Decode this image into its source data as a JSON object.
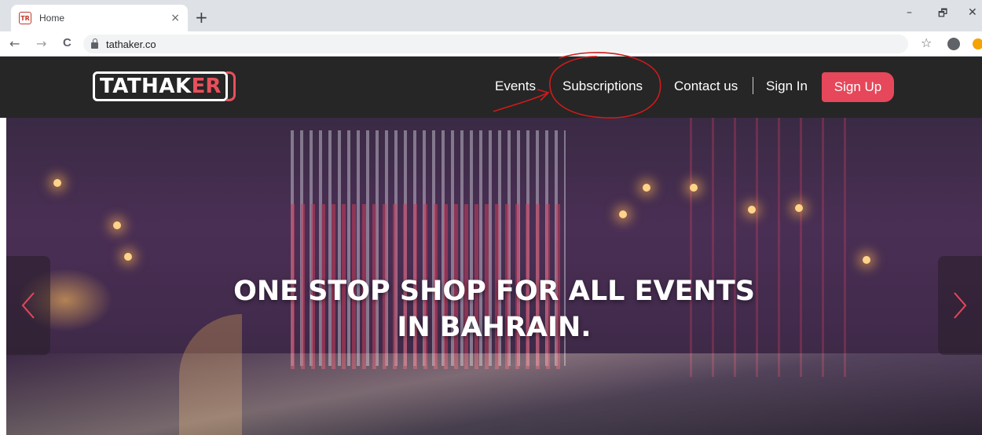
{
  "browser": {
    "tab_title": "Home",
    "tab_close": "×",
    "new_tab": "+",
    "favicon": "TR",
    "url": "tathaker.co",
    "nav": {
      "back": "←",
      "forward": "→",
      "reload": "C"
    },
    "window": {
      "minimize": "–",
      "restore": "🗗",
      "close": "✕"
    },
    "toolbar_icons": [
      "star-icon",
      "account-icon",
      "extension-icon"
    ]
  },
  "site": {
    "logo_main": "TATHAK",
    "logo_accent": "ER",
    "nav": {
      "events": "Events",
      "subscriptions": "Subscriptions",
      "contact": "Contact us",
      "signin": "Sign In",
      "signup": "Sign Up"
    },
    "hero": {
      "line1": "ONE STOP SHOP FOR ALL EVENTS",
      "line2": "IN BAHRAIN."
    }
  },
  "colors": {
    "header_bg": "#262626",
    "accent": "#e6475a",
    "annotation": "#d11a1a"
  },
  "annotation": {
    "shape": "circle-with-arrow",
    "target": "subscriptions"
  }
}
